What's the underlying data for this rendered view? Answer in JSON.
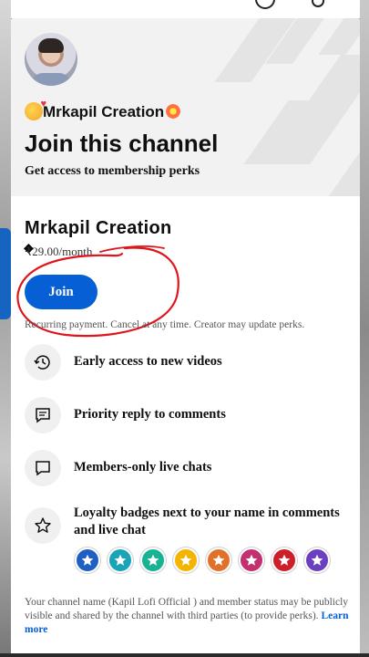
{
  "header": {
    "channel_tag": "Mrkapil Creation",
    "title": "Join this channel",
    "subtitle": "Get access to membership perks"
  },
  "membership": {
    "channel_name": "Mrkapil Creation",
    "price": "₹29.00/month",
    "join_label": "Join",
    "terms": "Recurring payment. Cancel at any time. Creator may update perks."
  },
  "perks": [
    {
      "label": "Early access to new videos",
      "icon": "history-clock-icon"
    },
    {
      "label": "Priority reply to comments",
      "icon": "comment-icon"
    },
    {
      "label": "Members-only live chats",
      "icon": "chat-bubble-icon"
    },
    {
      "label": "Loyalty badges next to your name in comments and live chat",
      "icon": "star-icon"
    }
  ],
  "badge_colors": [
    "#1e5fc4",
    "#1aa4b8",
    "#18b394",
    "#f4b400",
    "#e0702a",
    "#c2306f",
    "#cc1f2a",
    "#6a3fc0"
  ],
  "footer": {
    "text": "Your channel name (Kapil Lofi Official ) and member status may be publicly visible and shared by the channel with third parties (to provide perks).",
    "link": "Learn more"
  },
  "colors": {
    "accent": "#065fd4",
    "annotation": "#e0141c"
  }
}
